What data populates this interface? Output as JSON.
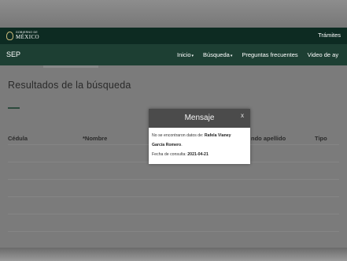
{
  "gov": {
    "logo_small": "GOBIERNO DE",
    "logo_big": "MÉXICO",
    "tramites": "Trámites"
  },
  "nav": {
    "brand": "SEP",
    "items": [
      "Inicio",
      "Búsqueda",
      "Preguntas frecuentes",
      "Video de ay"
    ]
  },
  "page": {
    "title": "Resultados de la búsqueda",
    "table_headers": [
      "Cédula",
      "*Nombre",
      "ndo apellido",
      "Tipo"
    ]
  },
  "modal": {
    "title": "Mensaje",
    "close": "x",
    "message_prefix": "No se encontraron datos de:",
    "name_first": "Rafela Vianey",
    "name_second": "García Romero",
    "date_label": "Fecha de consulta:",
    "date_value": "2021-04-21"
  }
}
